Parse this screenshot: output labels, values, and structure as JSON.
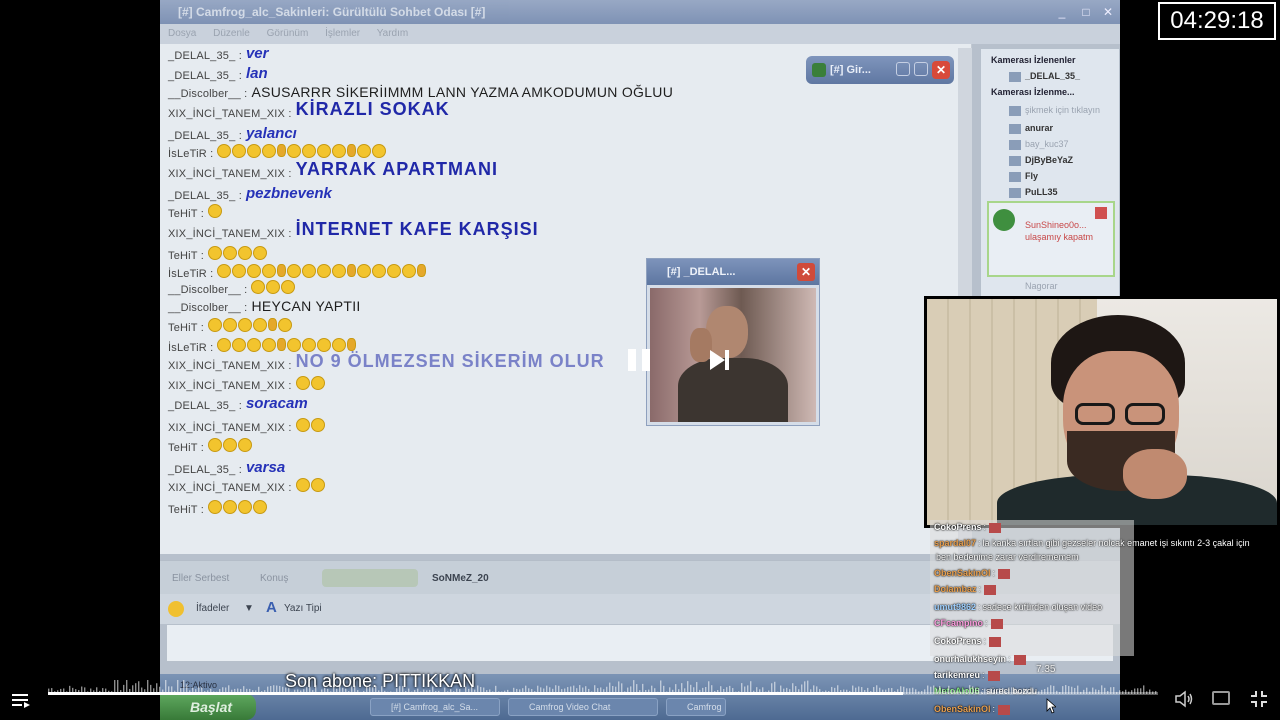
{
  "window": {
    "title": "[#] Camfrog_alc_Sakinleri: Gürültülü Sohbet Odası [#]",
    "menu": [
      "Dosya",
      "Düzenle",
      "Görünüm",
      "İşlemler",
      "Yardım"
    ]
  },
  "chat_log": [
    {
      "nick": "_DELAL_35_ :",
      "text": "ver",
      "style": "blue-i"
    },
    {
      "nick": "_DELAL_35_ :",
      "text": "lan",
      "style": "blue-i"
    },
    {
      "nick": "__Discolber__ :",
      "text": "ASUSARRR SİKERİIMMM LANN YAZMA AMKODUMUN OĞLUU",
      "style": "black"
    },
    {
      "nick": "XIX_İNCİ_TANEM_XIX :",
      "text": "KİRAZLI SOKAK",
      "style": "blue-big"
    },
    {
      "nick": "_DELAL_35_ :",
      "text": "yalancı",
      "style": "blue-i"
    },
    {
      "nick": "İsLeTiR :",
      "text": "",
      "style": "emoji",
      "emoji": 12
    },
    {
      "nick": "XIX_İNCİ_TANEM_XIX :",
      "text": "YARRAK APARTMANI",
      "style": "blue-big"
    },
    {
      "nick": "_DELAL_35_ :",
      "text": "pezbnevenk",
      "style": "blue-i"
    },
    {
      "nick": "TeHiT :",
      "text": "",
      "style": "emoji",
      "emoji": 1
    },
    {
      "nick": "XIX_İNCİ_TANEM_XIX :",
      "text": "İNTERNET KAFE KARŞISI",
      "style": "blue-big"
    },
    {
      "nick": "TeHiT :",
      "text": "",
      "style": "emoji",
      "emoji": 4
    },
    {
      "nick": "İsLeTiR :",
      "text": "",
      "style": "emoji",
      "emoji": 15
    },
    {
      "nick": "__Discolber__ :",
      "text": "",
      "style": "emoji",
      "emoji": 3
    },
    {
      "nick": "__Discolber__ :",
      "text": "HEYCAN YAPTII",
      "style": "black"
    },
    {
      "nick": "TeHiT :",
      "text": "",
      "style": "emoji",
      "emoji": 6
    },
    {
      "nick": "İsLeTiR :",
      "text": "",
      "style": "emoji",
      "emoji": 10
    },
    {
      "nick": "XIX_İNCİ_TANEM_XIX :",
      "text": "NO 9 ÖLMEZSEN SİKERİM OLUR",
      "style": "blue-big-faint"
    },
    {
      "nick": "XIX_İNCİ_TANEM_XIX :",
      "text": "",
      "style": "emoji",
      "emoji": 2
    },
    {
      "nick": "_DELAL_35_ :",
      "text": "soracam",
      "style": "blue-i"
    },
    {
      "nick": "XIX_İNCİ_TANEM_XIX :",
      "text": "",
      "style": "emoji",
      "emoji": 2
    },
    {
      "nick": "TeHiT :",
      "text": "",
      "style": "emoji",
      "emoji": 3
    },
    {
      "nick": "_DELAL_35_ :",
      "text": "varsa",
      "style": "blue-i"
    },
    {
      "nick": "XIX_İNCİ_TANEM_XIX :",
      "text": "",
      "style": "emoji",
      "emoji": 2
    },
    {
      "nick": "TeHiT :",
      "text": "",
      "style": "emoji",
      "emoji": 4
    }
  ],
  "mini_window": {
    "title": "[#] Gir..."
  },
  "cam_window": {
    "title": "[#] _DELAL..."
  },
  "user_list": {
    "header_1": "Kamerası İzlenenler",
    "header_2": "Kamerası İzlenme...",
    "users": [
      "_DELAL_35_",
      "şikmek için tıklayın",
      "anurar",
      "bay_kuc37",
      "DjByBeYaZ",
      "Fly",
      "PuLL35",
      "Nagorar"
    ],
    "popup_text": [
      "SunShineo0o...",
      "ulaşamıy kapatm"
    ]
  },
  "toolbar": {
    "eller_serbest": "Eller Serbest",
    "konus": "Konuş",
    "speaker": "SoNMeZ_20",
    "ifadeler": "İfadeler",
    "yazi_tipi": "Yazı Tipi"
  },
  "taskbar": {
    "start": "Başlat",
    "clock_label": "12:Aktivo",
    "tasks": [
      "[#] Camfrog_alc_Sa...",
      "Camfrog Video Chat",
      "Camfrog"
    ]
  },
  "stream": {
    "timer": "04:29:18",
    "subscriber": "Son abone: PITTIKKAN",
    "chat_time": "7:35",
    "progress_percent": 77,
    "chat": [
      {
        "user": "CokoPrens",
        "color": "#ffffff",
        "text": "",
        "emote": true
      },
      {
        "user": "spardal07",
        "color": "#e8a050",
        "text": "la kanka sırtlan gibi gezseler nolcak emanet işi sıkıntı 2-3 çakal için",
        "emote": false
      },
      {
        "user": "",
        "color": "#ffffff",
        "text": "ben bedenime zarar verdirememem",
        "emote": false
      },
      {
        "user": "ObenSakinOl",
        "color": "#e8a050",
        "text": "",
        "emote": true
      },
      {
        "user": "Dolambaz",
        "color": "#e8a050",
        "text": "",
        "emote": true
      },
      {
        "user": "umut9862",
        "color": "#9fd0ff",
        "text": "sadece küfürden oluşan video",
        "emote": false
      },
      {
        "user": "CFcampino",
        "color": "#ff9fe0",
        "text": "",
        "emote": true
      },
      {
        "user": "CokoPrens",
        "color": "#ffffff",
        "text": "",
        "emote": true
      },
      {
        "user": "onurhalukhseyin",
        "color": "#ffffff",
        "text": "",
        "emote": true
      },
      {
        "user": "tarikemreu",
        "color": "#ffffff",
        "text": "",
        "emote": true
      },
      {
        "user": "MetoAlo06",
        "color": "#7fe07f",
        "text": "süreci bozdu",
        "emote": false
      },
      {
        "user": "ObenSakinOl",
        "color": "#e8a050",
        "text": "",
        "emote": true
      }
    ]
  },
  "colors": {
    "accent_blue": "#2632b8",
    "timer_border": "#ffffff"
  }
}
